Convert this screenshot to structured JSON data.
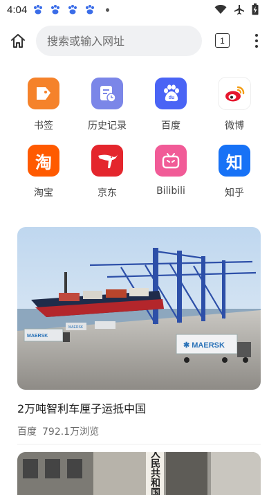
{
  "status_bar": {
    "time": "4:04",
    "notification_icons": [
      "baidu-paw-icon",
      "baidu-paw-icon",
      "baidu-paw-icon",
      "baidu-paw-icon"
    ],
    "system_icons": [
      "wifi-icon",
      "airplane-mode-icon",
      "battery-charging-icon"
    ]
  },
  "toolbar": {
    "search_placeholder": "搜索或输入网址",
    "tab_count": "1"
  },
  "shortcuts": [
    {
      "label": "书签",
      "icon": "bookmark-icon",
      "color": "#f5822a"
    },
    {
      "label": "历史记录",
      "icon": "history-icon",
      "color": "#7b86e8"
    },
    {
      "label": "百度",
      "icon": "baidu-icon",
      "color": "#4a64f5"
    },
    {
      "label": "微博",
      "icon": "weibo-icon",
      "color": "#ffffff"
    },
    {
      "label": "淘宝",
      "icon": "taobao-icon",
      "color": "#ff5a00"
    },
    {
      "label": "京东",
      "icon": "jd-icon",
      "color": "#e4262d"
    },
    {
      "label": "Bilibili",
      "icon": "bilibili-icon",
      "color": "#f15b97"
    },
    {
      "label": "知乎",
      "icon": "zhihu-icon",
      "color": "#1772f6"
    }
  ],
  "feed": [
    {
      "title": "2万吨智利车厘子运抵中国",
      "source": "百度",
      "views": "792.1万浏览",
      "image": "container-port-photo"
    },
    {
      "image": "building-sign-photo",
      "sign_text": "中华人民共和国"
    }
  ]
}
